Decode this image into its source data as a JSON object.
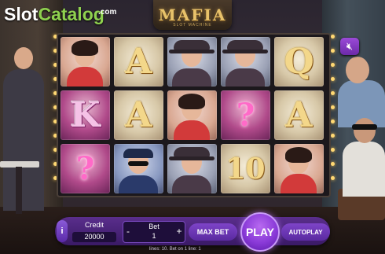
{
  "watermark": {
    "part1": "Slot",
    "part2": "Catalog",
    "suffix": ".com"
  },
  "logo": {
    "title": "MAFIA",
    "subtitle": "SLOT MACHINE"
  },
  "reels": [
    [
      {
        "symbol": "woman"
      },
      {
        "symbol": "A"
      },
      {
        "symbol": "gangster"
      },
      {
        "symbol": "gangster"
      },
      {
        "symbol": "Q"
      }
    ],
    [
      {
        "symbol": "K"
      },
      {
        "symbol": "A"
      },
      {
        "symbol": "woman"
      },
      {
        "symbol": "?"
      },
      {
        "symbol": "A"
      }
    ],
    [
      {
        "symbol": "?"
      },
      {
        "symbol": "cop"
      },
      {
        "symbol": "gangster"
      },
      {
        "symbol": "10"
      },
      {
        "symbol": "woman"
      }
    ]
  ],
  "controls": {
    "info_label": "i",
    "credit_label": "Credit",
    "credit_value": "20000",
    "bet_label": "Bet",
    "bet_value": "1",
    "bet_minus": "-",
    "bet_plus": "+",
    "max_bet_label": "MAX BET",
    "play_label": "PLAY",
    "autoplay_label": "AUTOPLAY",
    "mute_icon": "speaker-mute-icon"
  },
  "footer": {
    "lines_text": "lines: 10.",
    "bet_line_text": "Bet on 1 line: 1"
  },
  "colors": {
    "accent": "#8a3ad8",
    "button": "#6c2aa8",
    "watermark_green": "#8fd14f"
  }
}
